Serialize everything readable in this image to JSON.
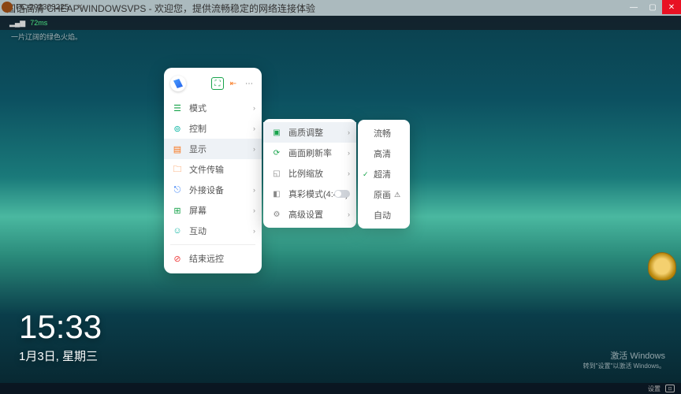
{
  "banner": "国语高清 CHEAPWINDOWSVPS - 欢迎您，提供流畅稳定的网络连接体验",
  "tab": {
    "label": "PC-202303225"
  },
  "remote": {
    "latency": "72ms",
    "signal": "▂▄▆"
  },
  "desktop_caption": "一片辽阔的绿色火焰。",
  "window_controls": {
    "min": "—",
    "max": "▢",
    "close": "✕"
  },
  "toolbar": {
    "header_btns": {
      "screen": "⛶",
      "collapse": "⇤",
      "more": "⋯"
    },
    "items": [
      {
        "icon": "☰",
        "label": "模式",
        "has_sub": true,
        "cls": "green"
      },
      {
        "icon": "⊚",
        "label": "控制",
        "has_sub": true,
        "cls": "teal"
      },
      {
        "icon": "▤",
        "label": "显示",
        "has_sub": true,
        "cls": "orange",
        "active": true
      },
      {
        "icon": "🗀",
        "label": "文件传输",
        "has_sub": false,
        "cls": "orange"
      },
      {
        "icon": "⎋",
        "label": "外接设备",
        "has_sub": true,
        "cls": "blue"
      },
      {
        "icon": "⊞",
        "label": "屏幕",
        "has_sub": true,
        "cls": "green"
      },
      {
        "icon": "☺",
        "label": "互动",
        "has_sub": true,
        "cls": "teal"
      }
    ],
    "end": {
      "icon": "⊘",
      "label": "结束远控",
      "cls": "red"
    }
  },
  "submenu1": [
    {
      "icon": "▣",
      "label": "画质调整",
      "has_sub": true,
      "active": true
    },
    {
      "icon": "⟳",
      "label": "画面刷新率",
      "has_sub": true
    },
    {
      "icon": "◱",
      "label": "比例缩放",
      "has_sub": true,
      "gray": true
    },
    {
      "icon": "◧",
      "label": "真彩模式(4:4:4)",
      "toggle": true,
      "gray": true
    },
    {
      "icon": "⚙",
      "label": "高级设置",
      "has_sub": true,
      "gray": true
    }
  ],
  "submenu2": [
    {
      "label": "流畅"
    },
    {
      "label": "高清"
    },
    {
      "label": "超清",
      "checked": true
    },
    {
      "label": "原画",
      "warn": "⚠"
    },
    {
      "label": "自动"
    }
  ],
  "clock": {
    "time": "15:33",
    "date": "1月3日, 星期三"
  },
  "watermark": {
    "line1": "激活 Windows",
    "line2": "转到\"设置\"以激活 Windows。"
  },
  "tray": {
    "status": "设置"
  }
}
